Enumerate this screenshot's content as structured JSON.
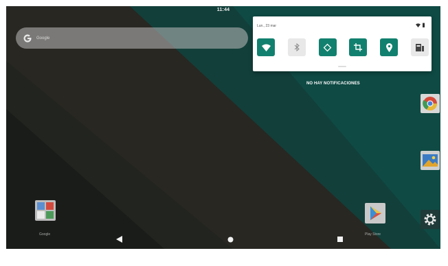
{
  "status_bar": {
    "time": "11:44"
  },
  "search": {
    "hint": "Google"
  },
  "quick_settings": {
    "date": "Lun., 23 mar",
    "tiles": [
      {
        "name": "wifi",
        "icon": "wifi-icon",
        "on": true
      },
      {
        "name": "bluetooth",
        "icon": "bluetooth-icon",
        "on": false
      },
      {
        "name": "auto-rotate",
        "icon": "rotate-icon",
        "on": true
      },
      {
        "name": "screenshot",
        "icon": "crop-icon",
        "on": true
      },
      {
        "name": "location",
        "icon": "location-icon",
        "on": true
      },
      {
        "name": "cast",
        "icon": "cast-icon",
        "on": false
      }
    ]
  },
  "notifications": {
    "empty_text": "NO HAY NOTIFICACIONES"
  },
  "apps": [
    {
      "name": "google-folder",
      "label": "Google"
    },
    {
      "name": "play-store",
      "label": "Play Store"
    },
    {
      "name": "chrome",
      "label": ""
    },
    {
      "name": "gallery",
      "label": ""
    },
    {
      "name": "settings",
      "label": ""
    }
  ],
  "colors": {
    "accent": "#12806e",
    "wallpaper_dark": "#1d1f1c",
    "wallpaper_teal": "#0f4a44"
  }
}
